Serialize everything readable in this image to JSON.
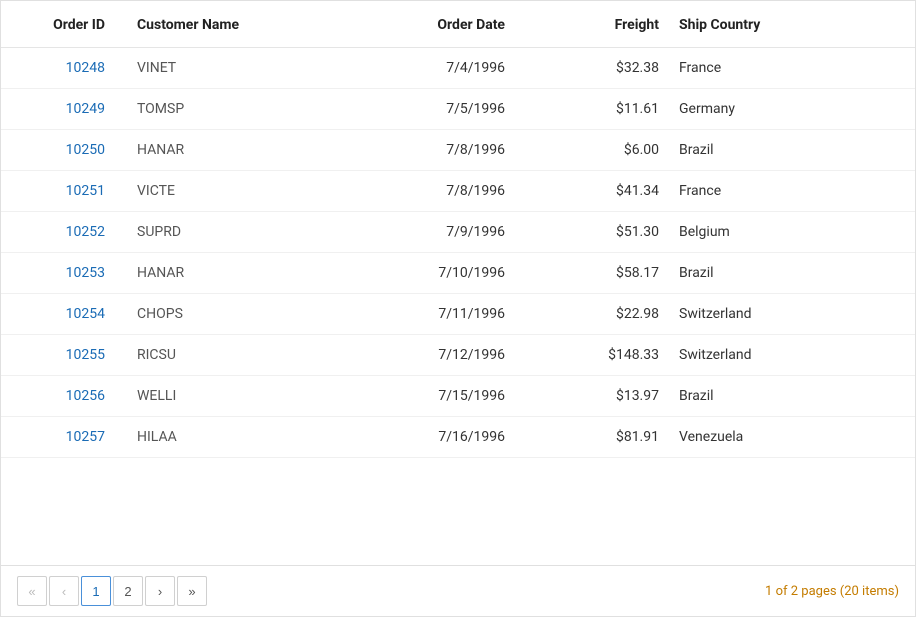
{
  "table": {
    "columns": [
      {
        "key": "orderid",
        "label": "Order ID"
      },
      {
        "key": "customer",
        "label": "Customer Name"
      },
      {
        "key": "date",
        "label": "Order Date"
      },
      {
        "key": "freight",
        "label": "Freight"
      },
      {
        "key": "country",
        "label": "Ship Country"
      }
    ],
    "rows": [
      {
        "orderid": "10248",
        "customer": "VINET",
        "date": "7/4/1996",
        "freight": "$32.38",
        "country": "France"
      },
      {
        "orderid": "10249",
        "customer": "TOMSP",
        "date": "7/5/1996",
        "freight": "$11.61",
        "country": "Germany"
      },
      {
        "orderid": "10250",
        "customer": "HANAR",
        "date": "7/8/1996",
        "freight": "$6.00",
        "country": "Brazil"
      },
      {
        "orderid": "10251",
        "customer": "VICTE",
        "date": "7/8/1996",
        "freight": "$41.34",
        "country": "France"
      },
      {
        "orderid": "10252",
        "customer": "SUPRD",
        "date": "7/9/1996",
        "freight": "$51.30",
        "country": "Belgium"
      },
      {
        "orderid": "10253",
        "customer": "HANAR",
        "date": "7/10/1996",
        "freight": "$58.17",
        "country": "Brazil"
      },
      {
        "orderid": "10254",
        "customer": "CHOPS",
        "date": "7/11/1996",
        "freight": "$22.98",
        "country": "Switzerland"
      },
      {
        "orderid": "10255",
        "customer": "RICSU",
        "date": "7/12/1996",
        "freight": "$148.33",
        "country": "Switzerland"
      },
      {
        "orderid": "10256",
        "customer": "WELLI",
        "date": "7/15/1996",
        "freight": "$13.97",
        "country": "Brazil"
      },
      {
        "orderid": "10257",
        "customer": "HILAA",
        "date": "7/16/1996",
        "freight": "$81.91",
        "country": "Venezuela"
      }
    ]
  },
  "pagination": {
    "first_label": "«",
    "prev_label": "‹",
    "next_label": "›",
    "last_label": "»",
    "pages": [
      "1",
      "2"
    ],
    "current_page": "1",
    "info": "1 of 2 pages (20 items)"
  }
}
